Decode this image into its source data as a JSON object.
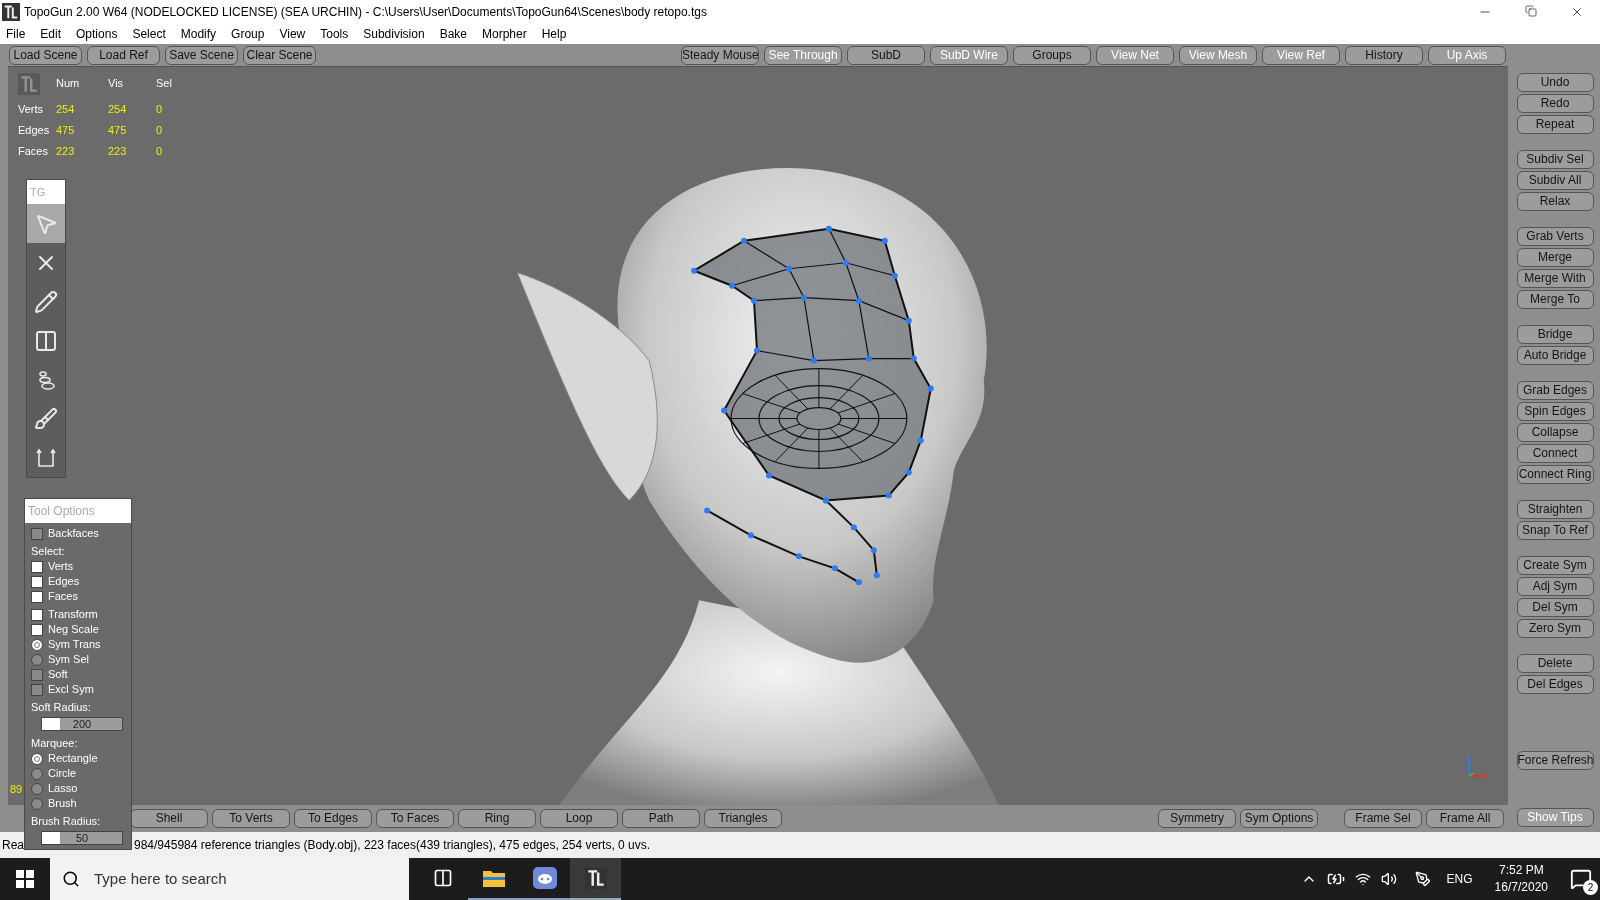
{
  "window": {
    "title": "TopoGun 2.00 W64  (NODELOCKED LICENSE) (SEA URCHIN) - C:\\Users\\User\\Documents\\TopoGun64\\Scenes\\body retopo.tgs"
  },
  "menu": [
    "File",
    "Edit",
    "Options",
    "Select",
    "Modify",
    "Group",
    "View",
    "Tools",
    "Subdivision",
    "Bake",
    "Morpher",
    "Help"
  ],
  "top_toolbar": {
    "left": [
      {
        "label": "Load Scene",
        "dimmed": false
      },
      {
        "label": "Load Ref",
        "dimmed": false
      },
      {
        "label": "Save Scene",
        "dimmed": false
      },
      {
        "label": "Clear Scene",
        "dimmed": false
      }
    ],
    "right": [
      {
        "label": "Steady Mouse",
        "dimmed": false
      },
      {
        "label": "See Through",
        "dimmed": true
      },
      {
        "label": "SubD",
        "dimmed": false
      },
      {
        "label": "SubD Wire",
        "dimmed": true
      },
      {
        "label": "Groups",
        "dimmed": false
      },
      {
        "label": "View Net",
        "dimmed": true
      },
      {
        "label": "View Mesh",
        "dimmed": true
      },
      {
        "label": "View Ref",
        "dimmed": true
      },
      {
        "label": "History",
        "dimmed": false
      },
      {
        "label": "Up Axis",
        "dimmed": true
      }
    ]
  },
  "stats": {
    "columns": [
      "Num",
      "Vis",
      "Sel"
    ],
    "rows": [
      {
        "label": "Verts",
        "values": [
          "254",
          "254",
          "0"
        ]
      },
      {
        "label": "Edges",
        "values": [
          "475",
          "475",
          "0"
        ]
      },
      {
        "label": "Faces",
        "values": [
          "223",
          "223",
          "0"
        ]
      }
    ]
  },
  "tool_palette": {
    "title": "TG",
    "tools": [
      {
        "selected": true
      },
      {
        "selected": false
      },
      {
        "selected": false
      },
      {
        "selected": false
      },
      {
        "selected": false
      },
      {
        "selected": false
      },
      {
        "selected": false
      }
    ]
  },
  "tool_options": {
    "title": "Tool Options",
    "sections": [
      {
        "items": [
          {
            "kind": "checkbox",
            "label": "Backfaces",
            "checked": false,
            "disabled": true
          }
        ]
      },
      {
        "heading": "Select:",
        "items": [
          {
            "kind": "checkbox",
            "label": "Verts",
            "checked": false,
            "disabled": false
          },
          {
            "kind": "checkbox",
            "label": "Edges",
            "checked": false,
            "disabled": false
          },
          {
            "kind": "checkbox",
            "label": "Faces",
            "checked": false,
            "disabled": false
          }
        ]
      },
      {
        "items": [
          {
            "kind": "checkbox",
            "label": "Transform",
            "checked": false,
            "disabled": false
          },
          {
            "kind": "checkbox",
            "label": "Neg Scale",
            "checked": false,
            "disabled": false
          },
          {
            "kind": "radio",
            "label": "Sym Trans",
            "selected": true
          },
          {
            "kind": "radio",
            "label": "Sym Sel",
            "selected": false
          },
          {
            "kind": "checkbox",
            "label": "Soft",
            "checked": false,
            "disabled": true
          },
          {
            "kind": "checkbox",
            "label": "Excl Sym",
            "checked": false,
            "disabled": true
          }
        ]
      },
      {
        "heading": "Soft Radius:",
        "items": [
          {
            "kind": "slider",
            "value": "200",
            "level": 0.22
          }
        ]
      },
      {
        "heading": "Marquee:",
        "items": [
          {
            "kind": "radio",
            "label": "Rectangle",
            "selected": true
          },
          {
            "kind": "radio",
            "label": "Circle",
            "selected": false
          },
          {
            "kind": "radio",
            "label": "Lasso",
            "selected": false
          },
          {
            "kind": "radio",
            "label": "Brush",
            "selected": false
          }
        ]
      },
      {
        "heading": "Brush Radius:",
        "items": [
          {
            "kind": "slider",
            "value": "50",
            "level": 0.22
          }
        ]
      }
    ]
  },
  "viewport": {
    "corner_number": "89"
  },
  "right_toolbar": [
    [
      "Undo",
      "Redo",
      "Repeat"
    ],
    [
      "Subdiv Sel",
      "Subdiv All",
      "Relax"
    ],
    [
      "Grab Verts",
      "Merge",
      "Merge With",
      "Merge To"
    ],
    [
      "Bridge",
      "Auto Bridge"
    ],
    [
      "Grab Edges",
      "Spin Edges",
      "Collapse",
      "Connect",
      "Connect Ring"
    ],
    [
      "Straighten",
      "Snap To Ref"
    ],
    [
      "Create Sym",
      "Adj Sym",
      "Del Sym",
      "Zero Sym"
    ],
    [
      "Delete",
      "Del Edges"
    ],
    [
      "Force Refresh"
    ]
  ],
  "bottom_toolbar": {
    "left": [
      "Shell",
      "To Verts",
      "To Edges",
      "To Faces",
      "Ring",
      "Loop",
      "Path",
      "Triangles"
    ],
    "right": [
      [
        "Symmetry",
        "Sym Options"
      ],
      [
        "Frame Sel",
        "Frame All"
      ]
    ],
    "tips": {
      "label": "Show Tips",
      "dimmed": true
    }
  },
  "status_bar": [
    "Rea",
    "984/945984 reference triangles (Body.obj), 223 faces(439 triangles), 475 edges, 254 verts, 0 uvs."
  ],
  "taskbar": {
    "search": {
      "placeholder": "Type here to search"
    },
    "apps": [
      {
        "selected": false
      },
      {
        "selected": false
      },
      {
        "selected": false
      },
      {
        "selected": true
      }
    ],
    "language": "ENG",
    "time": "7:52 PM",
    "date": "16/7/2020",
    "notifications": "2"
  }
}
